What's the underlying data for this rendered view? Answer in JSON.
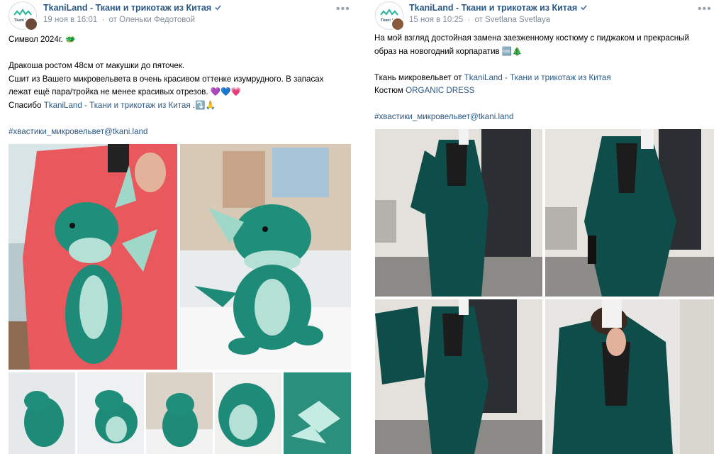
{
  "posts": [
    {
      "group_name": "TkaniLand - Ткани и трикотаж из Китая",
      "date": "19 ноя в 16:01",
      "author": "от Оленьки Федотовой",
      "lines": [
        "Символ 2024г. 🐲",
        "",
        "Дракоша ростом 48см от макушки до пяточек.",
        "Сшит из Вашего микровельвета в очень красивом оттенке изумрудного. В запасах",
        "лежат ещё пара/тройка не менее красивых отрезов. 💜💙💗"
      ],
      "thanks_prefix": "Спасибо ",
      "thanks_link": "TkaniLand - Ткани и трикотаж из Китая",
      "thanks_suffix": " .⤵️🙏",
      "hashtag": "#хвастики_микровельвет@tkani.land"
    },
    {
      "group_name": "TkaniLand - Ткани и трикотаж из Китая",
      "date": "15 ноя в 10:25",
      "author": "от Svetlana Svetlaya",
      "lines": [
        "На мой взгляд достойная замена заезженному костюму с пиджаком и прекрасный",
        "образ на новогодний корпаратив 🆒🎄"
      ],
      "fabric_prefix": "Ткань микровельвет от ",
      "fabric_link": "TkaniLand - Ткани и трикотаж из Китая",
      "suit_prefix": "Костюм ",
      "suit_link": "ORGANIC DRESS",
      "hashtag": "#хвастики_микровельвет@tkani.land"
    }
  ],
  "logo_text": "Tkani Land",
  "icons": {
    "more": "more-icon",
    "verified": "verified-icon"
  },
  "colors": {
    "link": "#2a5885",
    "meta": "#818c99",
    "emerald": "#1e8a78",
    "suit": "#0e4d4a"
  }
}
